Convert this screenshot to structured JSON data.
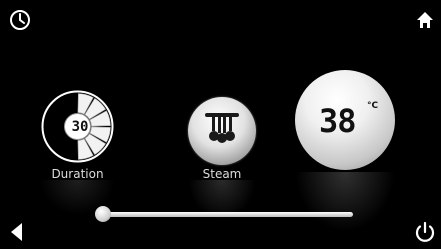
{
  "icons": {
    "clock": "clock-icon",
    "home": "home-icon",
    "back": "back-arrow-icon",
    "power": "power-icon",
    "steam": "shower-head-icon"
  },
  "duration": {
    "value": "30",
    "label": "Duration",
    "filled_segments_fraction": 0.5
  },
  "steam": {
    "label": "Steam"
  },
  "temperature": {
    "value": "38",
    "unit": "°C"
  },
  "slider": {
    "level_percent": 0
  },
  "colors": {
    "background": "#000000",
    "foreground": "#ffffff"
  }
}
